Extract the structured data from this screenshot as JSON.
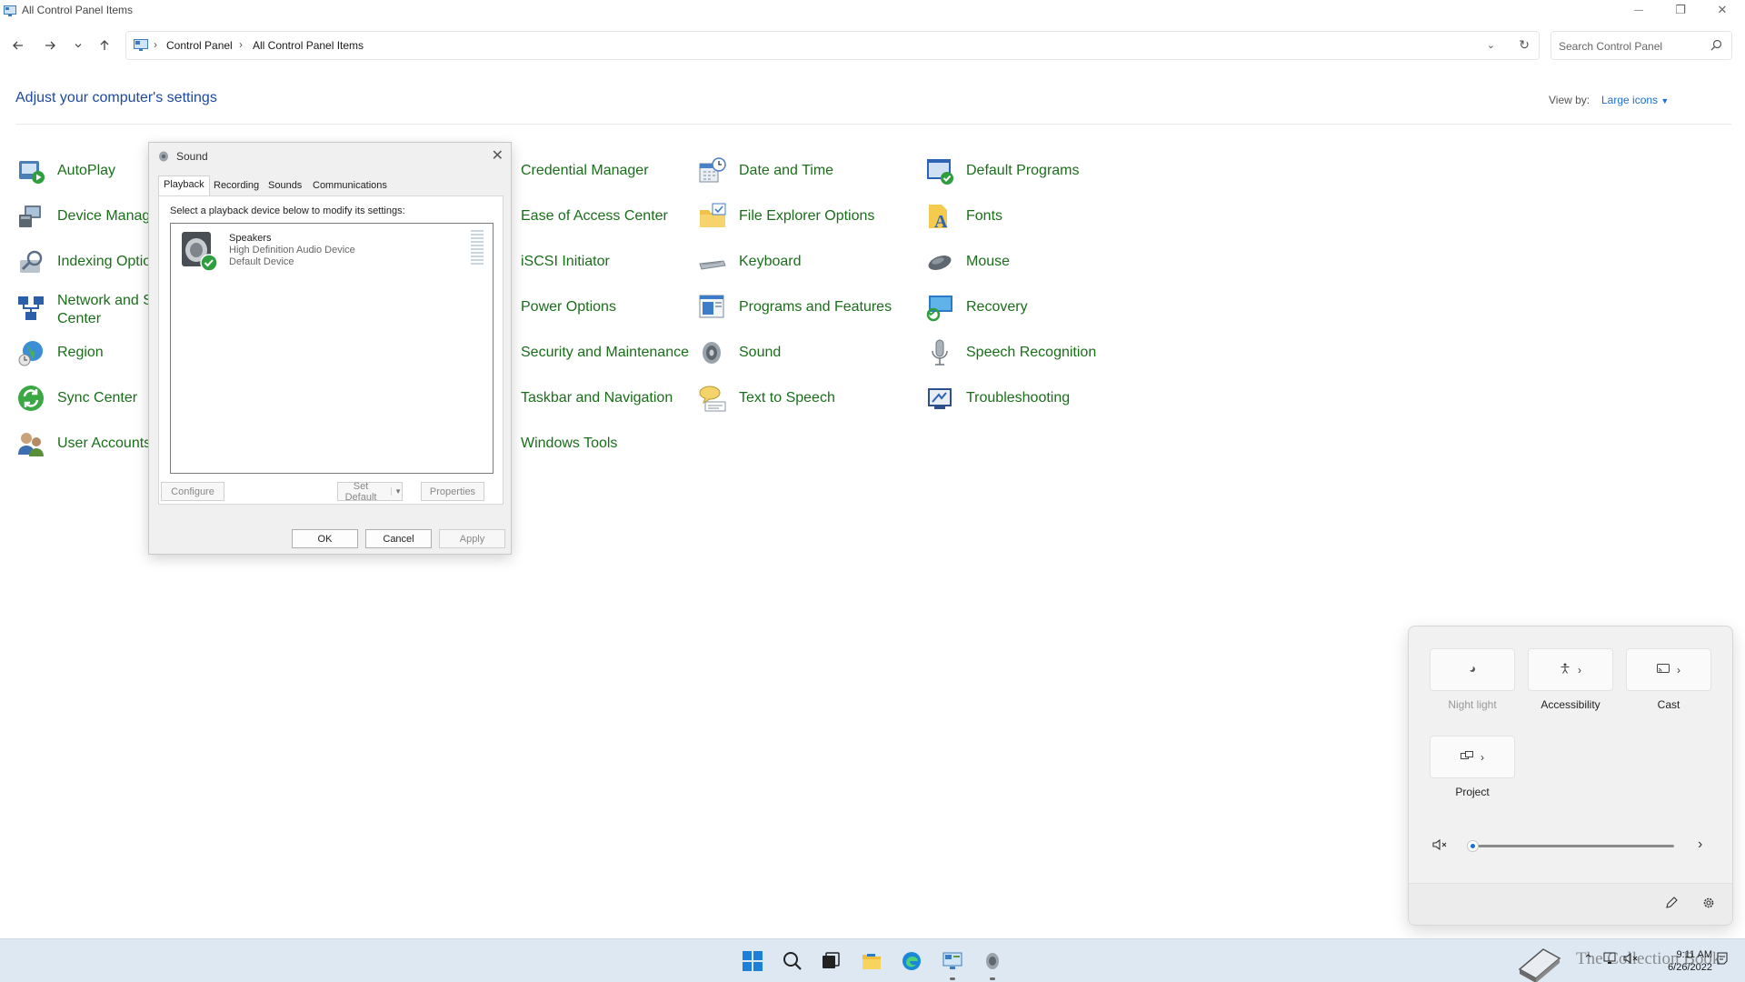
{
  "window": {
    "title": "All Control Panel Items",
    "controls": {
      "minimize": "—",
      "maximize": "❐",
      "close": "✕"
    }
  },
  "nav": {
    "breadcrumbs": [
      "Control Panel",
      "All Control Panel Items"
    ],
    "search_placeholder": "Search Control Panel"
  },
  "header": {
    "title": "Adjust your computer's settings",
    "view_by_label": "View by:",
    "view_by_value": "Large icons"
  },
  "items": {
    "autoplay": "AutoPlay",
    "device_manager": "Device Manage",
    "indexing_options": "Indexing Optio",
    "network_line1": "Network and S",
    "network_line2": "Center",
    "region": "Region",
    "sync_center": "Sync Center",
    "user_accounts": "User Accounts",
    "credential_manager": "Credential Manager",
    "ease_of_access": "Ease of Access Center",
    "iscsi": "iSCSI Initiator",
    "power_options": "Power Options",
    "security_maintenance": "Security and Maintenance",
    "taskbar_navigation": "Taskbar and Navigation",
    "windows_tools": "Windows Tools",
    "date_time": "Date and Time",
    "file_explorer_options": "File Explorer Options",
    "keyboard": "Keyboard",
    "programs_features": "Programs and Features",
    "sound": "Sound",
    "text_to_speech": "Text to Speech",
    "default_programs": "Default Programs",
    "fonts": "Fonts",
    "mouse": "Mouse",
    "recovery": "Recovery",
    "speech_recognition": "Speech Recognition",
    "troubleshooting": "Troubleshooting"
  },
  "sound_dialog": {
    "title": "Sound",
    "tabs": {
      "playback": "Playback",
      "recording": "Recording",
      "sounds": "Sounds",
      "communications": "Communications"
    },
    "instruction": "Select a playback device below to modify its settings:",
    "device": {
      "name": "Speakers",
      "description": "High Definition Audio Device",
      "status": "Default Device"
    },
    "buttons": {
      "configure": "Configure",
      "set_default": "Set Default",
      "properties": "Properties",
      "ok": "OK",
      "cancel": "Cancel",
      "apply": "Apply"
    }
  },
  "quick_settings": {
    "tiles": {
      "night_light": "Night light",
      "accessibility": "Accessibility",
      "cast": "Cast",
      "project": "Project"
    },
    "volume_level": 0,
    "volume_muted": true
  },
  "taskbar": {
    "time": "9:11 AM",
    "date": "6/26/2022",
    "watermark": "The Collection Book"
  },
  "colors": {
    "link_green": "#1a6e1a",
    "heading_blue": "#1c4aa0",
    "accent_blue": "#1c6fcf",
    "taskbar_bg": "#dde8f2"
  }
}
